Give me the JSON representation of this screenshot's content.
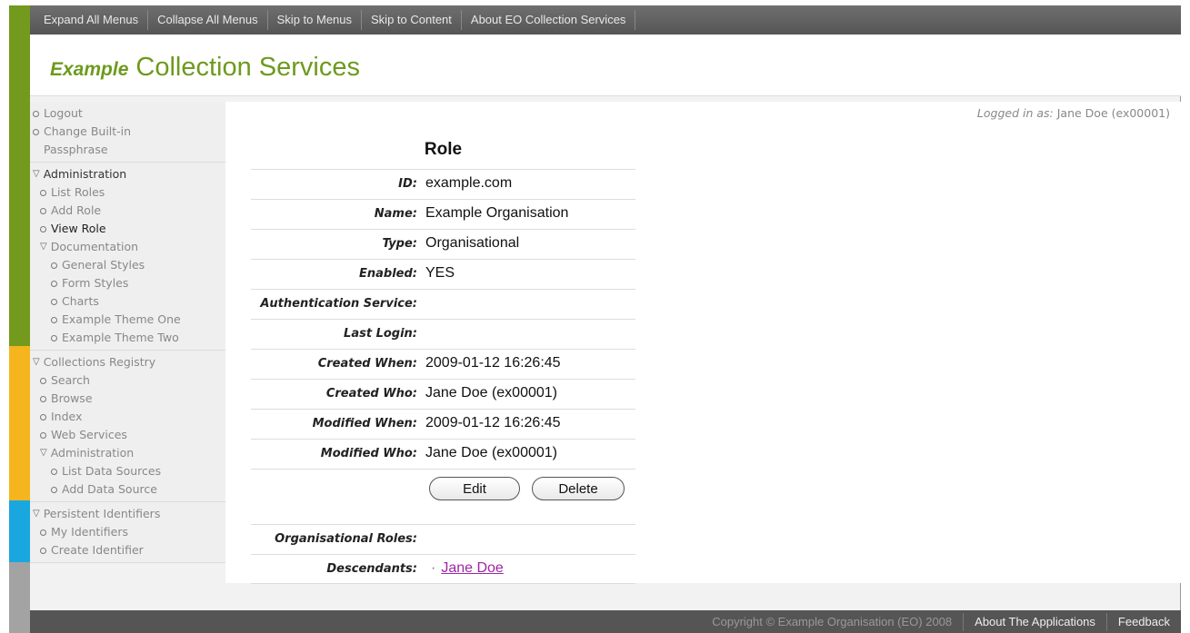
{
  "topbar": {
    "links": [
      "Expand All Menus",
      "Collapse All Menus",
      "Skip to Menus",
      "Skip to Content",
      "About EO Collection Services"
    ]
  },
  "header": {
    "brand_example": "Example",
    "brand_title": "Collection Services"
  },
  "sidebar": {
    "logout": "Logout",
    "change_pass_1": "Change Built-in",
    "change_pass_2": "Passphrase",
    "admin": "Administration",
    "list_roles": "List Roles",
    "add_role": "Add Role",
    "view_role": "View Role",
    "documentation": "Documentation",
    "general_styles": "General Styles",
    "form_styles": "Form Styles",
    "charts": "Charts",
    "theme_one": "Example Theme One",
    "theme_two": "Example Theme Two",
    "collections_registry": "Collections Registry",
    "search": "Search",
    "browse": "Browse",
    "index": "Index",
    "web_services": "Web Services",
    "admin2": "Administration",
    "list_data_sources": "List Data Sources",
    "add_data_source": "Add Data Source",
    "persistent_identifiers": "Persistent Identifiers",
    "my_identifiers": "My Identifiers",
    "create_identifier": "Create Identifier"
  },
  "main": {
    "logged_prefix": "Logged in as:",
    "logged_user": "Jane Doe (ex00001)",
    "title": "Role",
    "fields": [
      {
        "label": "ID:",
        "value": "example.com"
      },
      {
        "label": "Name:",
        "value": "Example Organisation"
      },
      {
        "label": "Type:",
        "value": "Organisational"
      },
      {
        "label": "Enabled:",
        "value": "YES"
      },
      {
        "label": "Authentication Service:",
        "value": ""
      },
      {
        "label": "Last Login:",
        "value": ""
      },
      {
        "label": "Created When:",
        "value": "2009-01-12 16:26:45"
      },
      {
        "label": "Created Who:",
        "value": "Jane Doe (ex00001)"
      },
      {
        "label": "Modified When:",
        "value": "2009-01-12 16:26:45"
      },
      {
        "label": "Modified Who:",
        "value": "Jane Doe (ex00001)"
      }
    ],
    "edit_label": "Edit",
    "delete_label": "Delete",
    "org_roles_label": "Organisational Roles:",
    "descendants_label": "Descendants:",
    "descendant_link": "Jane Doe"
  },
  "footer": {
    "copyright": "Copyright © Example Organisation (EO) 2008",
    "about": "About The Applications",
    "feedback": "Feedback"
  }
}
